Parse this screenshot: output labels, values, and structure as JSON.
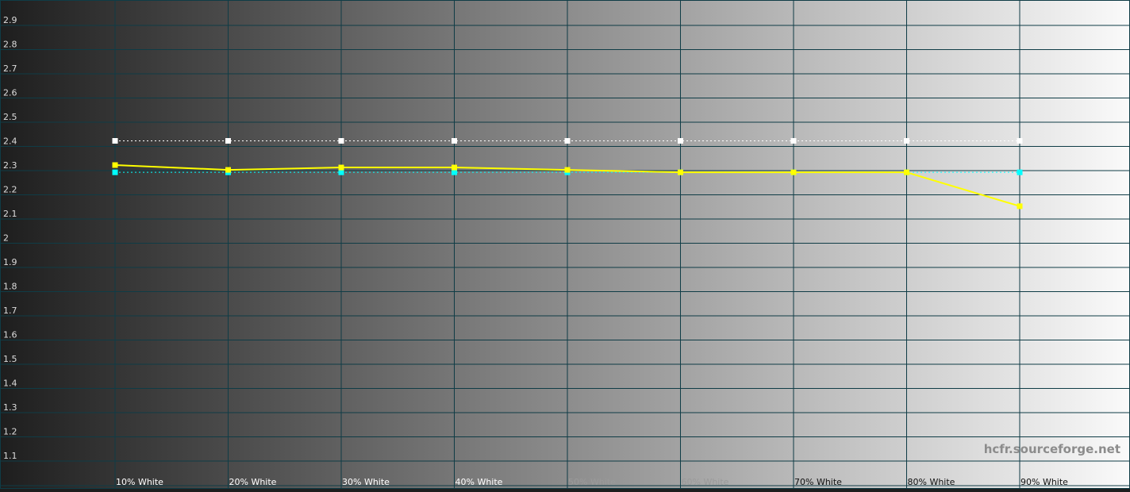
{
  "chart_data": {
    "type": "line",
    "categories": [
      "10% White",
      "20% White",
      "30% White",
      "40% White",
      "50% White",
      "60% White",
      "70% White",
      "80% White",
      "90% White"
    ],
    "series": [
      {
        "values": [
          2.3,
          2.28,
          2.29,
          2.29,
          2.28,
          2.27,
          2.27,
          2.27,
          2.13
        ]
      },
      {
        "values": [
          2.4,
          2.4,
          2.4,
          2.4,
          2.4,
          2.4,
          2.4,
          2.4,
          2.4
        ]
      },
      {
        "values": [
          2.27,
          2.27,
          2.27,
          2.27,
          2.27,
          2.27,
          2.27,
          2.27,
          2.27
        ]
      }
    ],
    "title": "",
    "xlabel": "",
    "ylabel": "",
    "ylim": [
      1.0,
      2.95
    ],
    "yticks": [
      "1.1",
      "1.2",
      "1.3",
      "1.4",
      "1.5",
      "1.6",
      "1.7",
      "1.8",
      "1.9",
      "2",
      "2.1",
      "2.2",
      "2.3",
      "2.4",
      "2.5",
      "2.6",
      "2.7",
      "2.8",
      "2.9"
    ],
    "grid": true,
    "legend": "none",
    "annotation": "hcfr.sourceforge.net",
    "colors": {
      "gamma_line": "#ffff00",
      "target_line": "#ffffff",
      "reference_line": "#00ffff",
      "grid": "#0f3c46",
      "gradient_dark": "#1e1e1e",
      "gradient_light": "#fafafa"
    }
  }
}
